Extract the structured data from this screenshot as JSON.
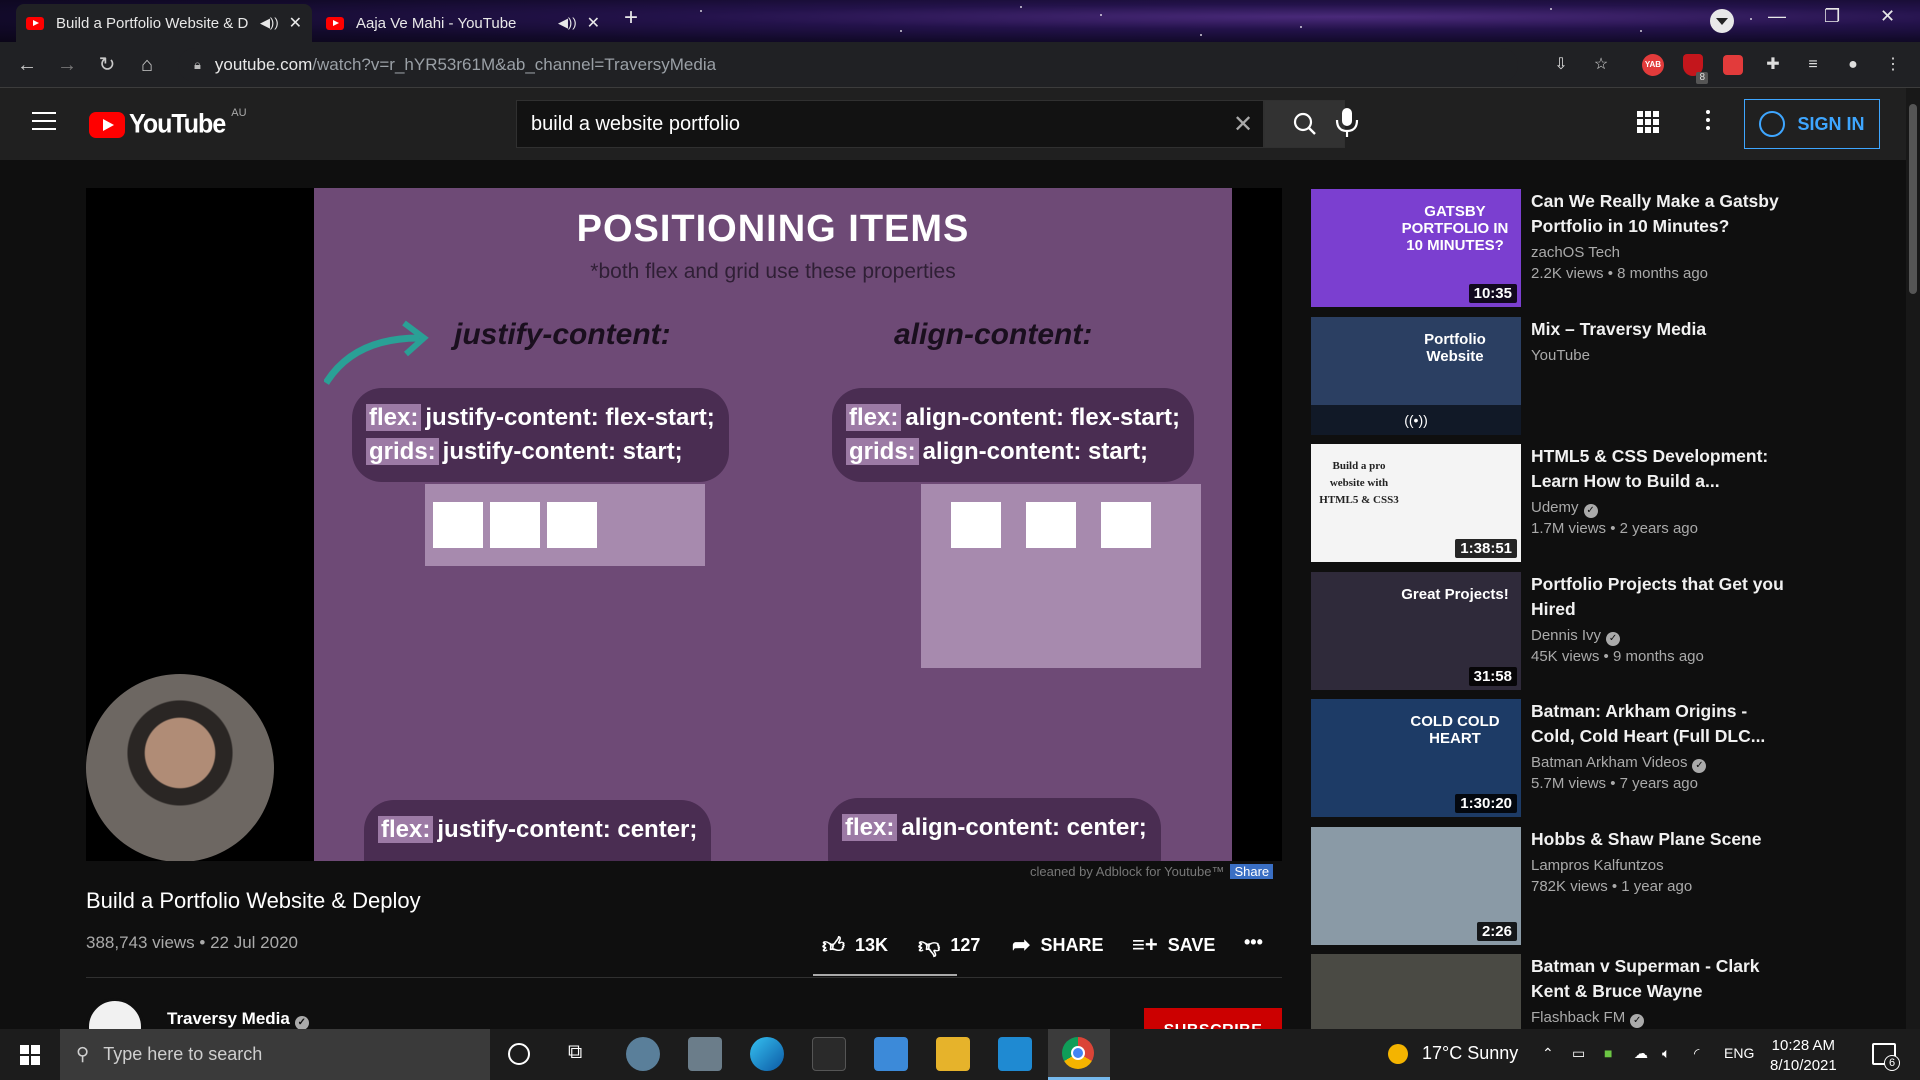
{
  "browser": {
    "tabs": [
      {
        "title": "Build a Portfolio Website & D",
        "active": true
      },
      {
        "title": "Aaja Ve Mahi - YouTube",
        "active": false
      }
    ],
    "new_tab": "+",
    "url_host": "youtube.com",
    "url_path": "/watch?v=r_hYR53r61M&ab_channel=TraversyMedia",
    "profile_badge": "8"
  },
  "youtube": {
    "logo_text": "YouTube",
    "country_code": "AU",
    "search_query": "build a website portfolio",
    "sign_in": "SIGN IN"
  },
  "slide": {
    "title": "POSITIONING ITEMS",
    "subtitle": "*both flex and grid use these properties",
    "left_head": "justify-content:",
    "right_head": "align-content:",
    "left_lines": [
      {
        "tag": "flex:",
        "code": "justify-content: flex-start;"
      },
      {
        "tag": "grids:",
        "code": "justify-content: start;"
      }
    ],
    "right_lines": [
      {
        "tag": "flex:",
        "code": "align-content: flex-start;"
      },
      {
        "tag": "grids:",
        "code": "align-content: start;"
      }
    ],
    "left_bottom": {
      "tag": "flex:",
      "code": "justify-content: center;"
    },
    "right_bottom": {
      "tag": "flex:",
      "code": "align-content: center;"
    }
  },
  "adblock": {
    "text": "cleaned by Adblock for Youtube™",
    "share": "Share"
  },
  "video": {
    "title": "Build a Portfolio Website & Deploy",
    "meta": "388,743 views • 22 Jul 2020",
    "likes": "13K",
    "dislikes": "127",
    "share": "SHARE",
    "save": "SAVE",
    "channel": "Traversy Media",
    "subscribe": "SUBSCRIBE"
  },
  "recommendations": [
    {
      "title": "Can We Really Make a Gatsby Portfolio in 10 Minutes?",
      "channel": "zachOS Tech",
      "verified": false,
      "views": "2.2K views • 8 months ago",
      "duration": "10:35",
      "thumb_text": "GATSBY PORTFOLIO IN 10 MINUTES?",
      "thumb_color": "#7b3fd0"
    },
    {
      "title": "Mix – Traversy Media",
      "channel": "YouTube",
      "verified": false,
      "views": "",
      "duration": "",
      "thumb_text": "Portfolio Website",
      "thumb_color": "#2b3f62"
    },
    {
      "title": "HTML5 & CSS Development: Learn How to Build a...",
      "channel": "Udemy",
      "verified": true,
      "views": "1.7M views • 2 years ago",
      "duration": "1:38:51",
      "thumb_text": "Build a pro website with HTML5 & CSS3",
      "thumb_color": "#f4f4f4"
    },
    {
      "title": "Portfolio Projects that Get you Hired",
      "channel": "Dennis Ivy",
      "verified": true,
      "views": "45K views • 9 months ago",
      "duration": "31:58",
      "thumb_text": "Great Projects!",
      "thumb_color": "#2f2a3a"
    },
    {
      "title": "Batman: Arkham Origins - Cold, Cold Heart (Full DLC...",
      "channel": "Batman Arkham Videos",
      "verified": true,
      "views": "5.7M views • 7 years ago",
      "duration": "1:30:20",
      "thumb_text": "COLD COLD HEART",
      "thumb_color": "#1d3b66"
    },
    {
      "title": "Hobbs & Shaw Plane Scene",
      "channel": "Lampros Kalfuntzos",
      "verified": false,
      "views": "782K views • 1 year ago",
      "duration": "2:26",
      "thumb_text": "",
      "thumb_color": "#8a9aa6"
    },
    {
      "title": "Batman v Superman - Clark Kent & Bruce Wayne",
      "channel": "Flashback FM",
      "verified": true,
      "views": "",
      "duration": "",
      "thumb_text": "",
      "thumb_color": "#4a4a44"
    }
  ],
  "taskbar": {
    "search_placeholder": "Type here to search",
    "weather": "17°C  Sunny",
    "language": "ENG",
    "time": "10:28 AM",
    "date": "8/10/2021",
    "notifications": "6"
  }
}
